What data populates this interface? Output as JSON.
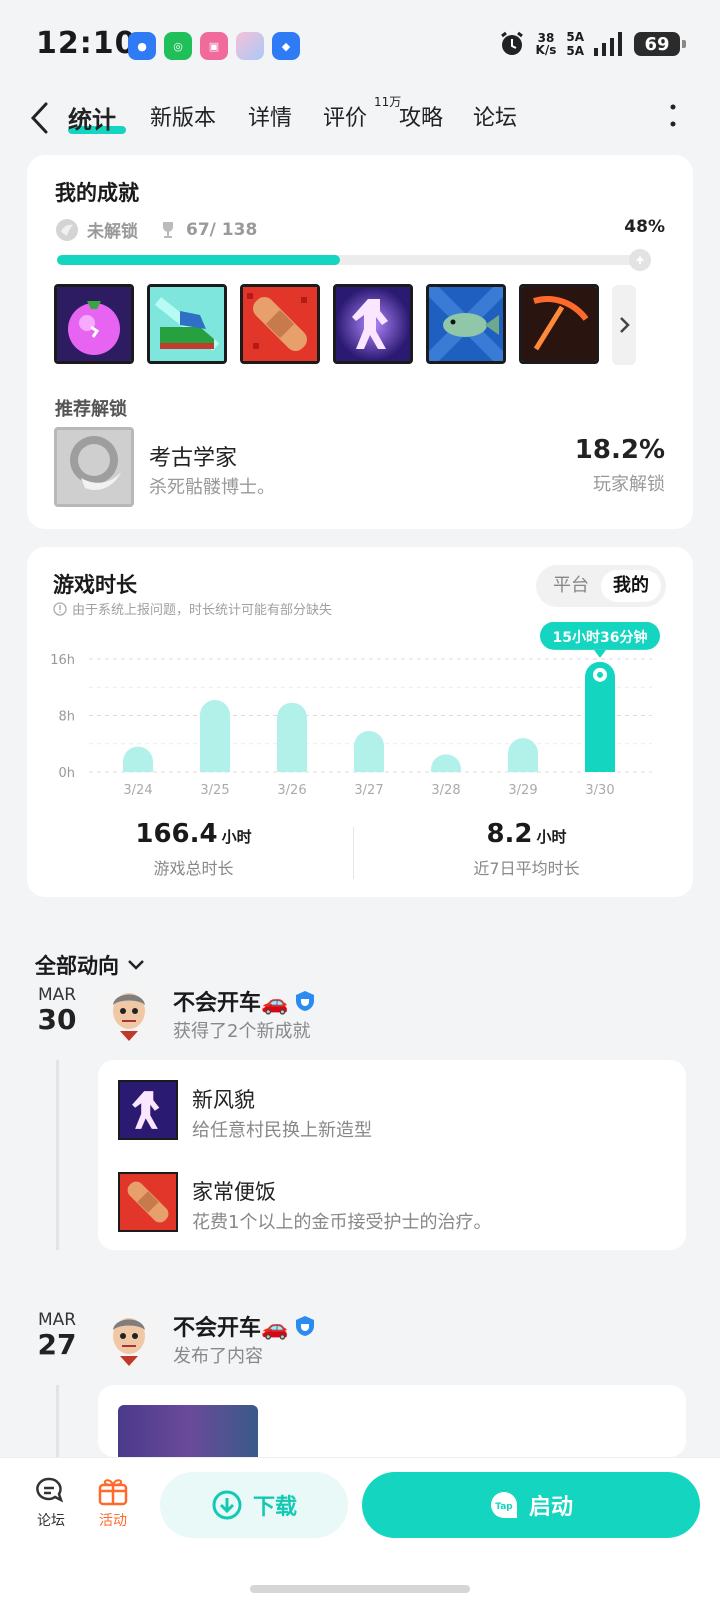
{
  "status_bar": {
    "time": "12:10",
    "net_speed_value": "38",
    "net_speed_unit": "K/s",
    "sim1": "5A",
    "sim2": "5A",
    "battery": "69"
  },
  "nav": {
    "tabs": [
      "统计",
      "新版本",
      "详情",
      "评价",
      "攻略",
      "论坛"
    ],
    "review_count": "11万"
  },
  "achievements": {
    "title": "我的成就",
    "locked_label": "未解锁",
    "count": "67/ 138",
    "percent_text": "48%",
    "progress": 0.48,
    "badges": [
      "eggplant",
      "sneaker",
      "bandage",
      "spirit",
      "fish",
      "pickaxe"
    ],
    "recommended": {
      "heading": "推荐解锁",
      "name": "考古学家",
      "desc": "杀死骷髅博士。",
      "percent": "18.2%",
      "percent_label": "玩家解锁"
    }
  },
  "playtime": {
    "title": "游戏时长",
    "note": "由于系统上报问题，时长统计可能有部分缺失",
    "toggle": [
      "平台",
      "我的"
    ],
    "tooltip": "15小时36分钟",
    "total_value": "166.4",
    "total_unit": "小时",
    "total_label": "游戏总时长",
    "avg_value": "8.2",
    "avg_unit": "小时",
    "avg_label": "近7日平均时长"
  },
  "chart_data": {
    "type": "bar",
    "categories": [
      "3/24",
      "3/25",
      "3/26",
      "3/27",
      "3/28",
      "3/29",
      "3/30"
    ],
    "values": [
      3.6,
      10.2,
      9.8,
      5.8,
      2.5,
      4.8,
      15.6
    ],
    "yticks": [
      "16h",
      "8h",
      "0h"
    ],
    "ylim": [
      0,
      16
    ],
    "highlight_index": 6,
    "colors": {
      "bar": "#b2f1ea",
      "highlight": "#14d5bf"
    }
  },
  "feed": {
    "heading": "全部动向",
    "entries": [
      {
        "month": "MAR",
        "day": "30",
        "user": "不会开车🚗",
        "action": "获得了2个新成就",
        "items": [
          {
            "title": "新风貌",
            "desc": "给任意村民换上新造型"
          },
          {
            "title": "家常便饭",
            "desc": "花费1个以上的金币接受护士的治疗。"
          }
        ]
      },
      {
        "month": "MAR",
        "day": "27",
        "user": "不会开车🚗",
        "action": "发布了内容"
      }
    ]
  },
  "bottom": {
    "forum": "论坛",
    "activity": "活动",
    "download": "下载",
    "start": "启动"
  }
}
